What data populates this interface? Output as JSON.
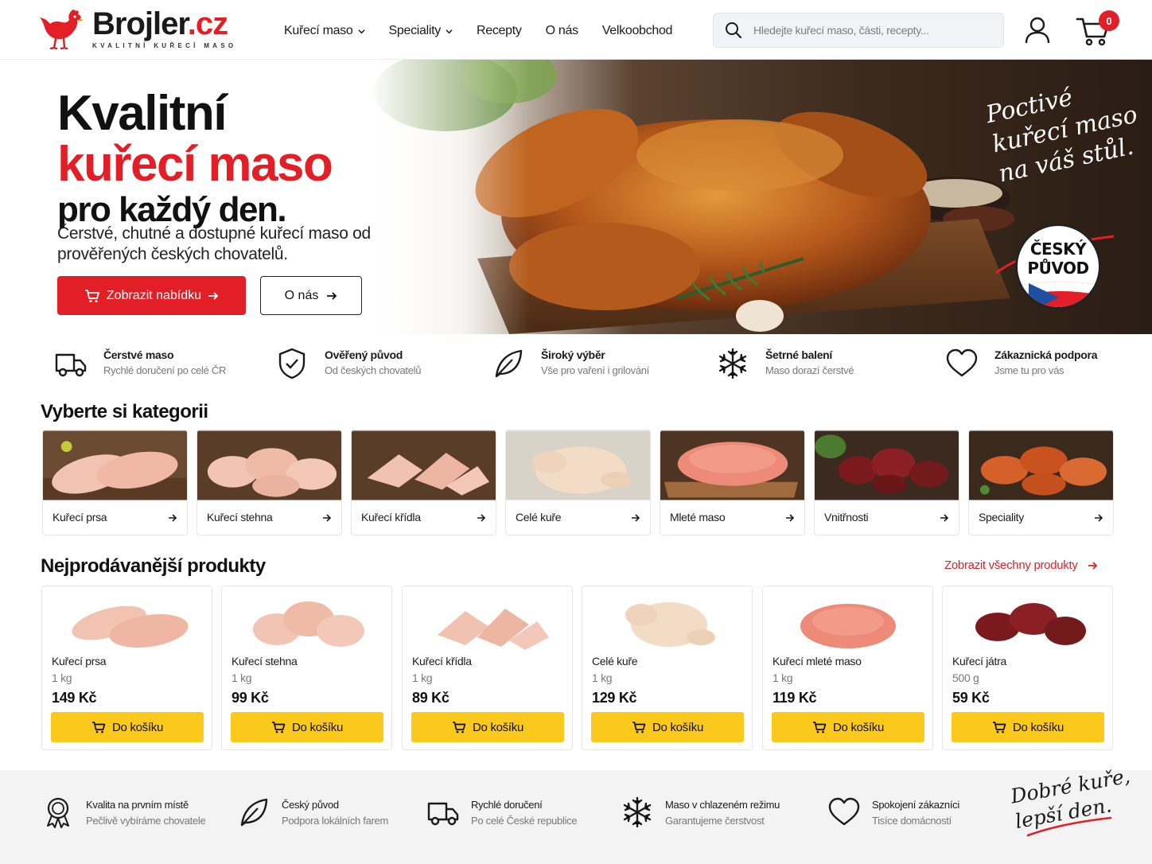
{
  "brand": {
    "name_main": "Brojler",
    "name_tld": ".cz",
    "tagline": "KVALITNÍ KUŘECÍ MASO",
    "accent_color": "#e21f26",
    "button_color": "#fbc91b"
  },
  "nav": [
    {
      "label": "Kuřecí maso",
      "dropdown": true
    },
    {
      "label": "Speciality",
      "dropdown": true
    },
    {
      "label": "Recepty",
      "dropdown": false
    },
    {
      "label": "O nás",
      "dropdown": false
    },
    {
      "label": "Velkoobchod",
      "dropdown": false
    }
  ],
  "search": {
    "placeholder": "Hledejte kuřecí maso, části, recepty..."
  },
  "cart": {
    "count": "0"
  },
  "hero": {
    "line1": "Kvalitní",
    "line2": "kuřecí maso",
    "line3": "pro každý den.",
    "subtitle": "Čerstvé, chutné a dostupné kuřecí maso od prověřených českých chovatelů.",
    "primary_button": "Zobrazit nabídku",
    "secondary_button": "O nás",
    "script_lines": [
      "Poctivé",
      "kuřecí maso",
      "na váš stůl."
    ],
    "badge_line1": "ČESKÝ",
    "badge_line2": "PŮVOD"
  },
  "features": [
    {
      "icon": "truck-icon",
      "title": "Čerstvé maso",
      "subtitle": "Rychlé doručení po celé ČR"
    },
    {
      "icon": "shield-check-icon",
      "title": "Ověřený původ",
      "subtitle": "Od českých chovatelů"
    },
    {
      "icon": "leaf-icon",
      "title": "Široký výběr",
      "subtitle": "Vše pro vaření i grilování"
    },
    {
      "icon": "snowflake-icon",
      "title": "Šetrné balení",
      "subtitle": "Maso dorazí čerstvé"
    },
    {
      "icon": "heart-icon",
      "title": "Zákaznická podpora",
      "subtitle": "Jsme tu pro vás"
    }
  ],
  "categories_title": "Vyberte si kategorii",
  "categories": [
    {
      "label": "Kuřecí prsa"
    },
    {
      "label": "Kuřecí stehna"
    },
    {
      "label": "Kuřecí křídla"
    },
    {
      "label": "Celé kuře"
    },
    {
      "label": "Mleté maso"
    },
    {
      "label": "Vnitřnosti"
    },
    {
      "label": "Speciality"
    }
  ],
  "products_title": "Nejprodávanější produkty",
  "see_all": "Zobrazit všechny produkty",
  "products": [
    {
      "name": "Kuřecí prsa",
      "weight": "1 kg",
      "price": "149 Kč",
      "button": "Do košíku"
    },
    {
      "name": "Kuřecí stehna",
      "weight": "1 kg",
      "price": "99 Kč",
      "button": "Do košíku"
    },
    {
      "name": "Kuřecí křídla",
      "weight": "1 kg",
      "price": "89 Kč",
      "button": "Do košíku"
    },
    {
      "name": "Celé kuře",
      "weight": "1 kg",
      "price": "129 Kč",
      "button": "Do košíku"
    },
    {
      "name": "Kuřecí mleté maso",
      "weight": "1 kg",
      "price": "119 Kč",
      "button": "Do košíku"
    },
    {
      "name": "Kuřecí játra",
      "weight": "500 g",
      "price": "59 Kč",
      "button": "Do košíku"
    }
  ],
  "footer_features": [
    {
      "icon": "award-ribbon-icon",
      "title": "Kvalita na prvním místě",
      "subtitle": "Pečlivě vybíráme chovatele"
    },
    {
      "icon": "leaf-icon",
      "title": "Český původ",
      "subtitle": "Podpora lokálních farem"
    },
    {
      "icon": "truck-icon",
      "title": "Rychlé doručení",
      "subtitle": "Po celé České republice"
    },
    {
      "icon": "snowflake-icon",
      "title": "Maso v chlazeném režimu",
      "subtitle": "Garantujeme čerstvost"
    },
    {
      "icon": "heart-icon",
      "title": "Spokojení zákazníci",
      "subtitle": "Tisíce domácností"
    }
  ],
  "footer_script": [
    "Dobré kuře,",
    "lepší den."
  ]
}
